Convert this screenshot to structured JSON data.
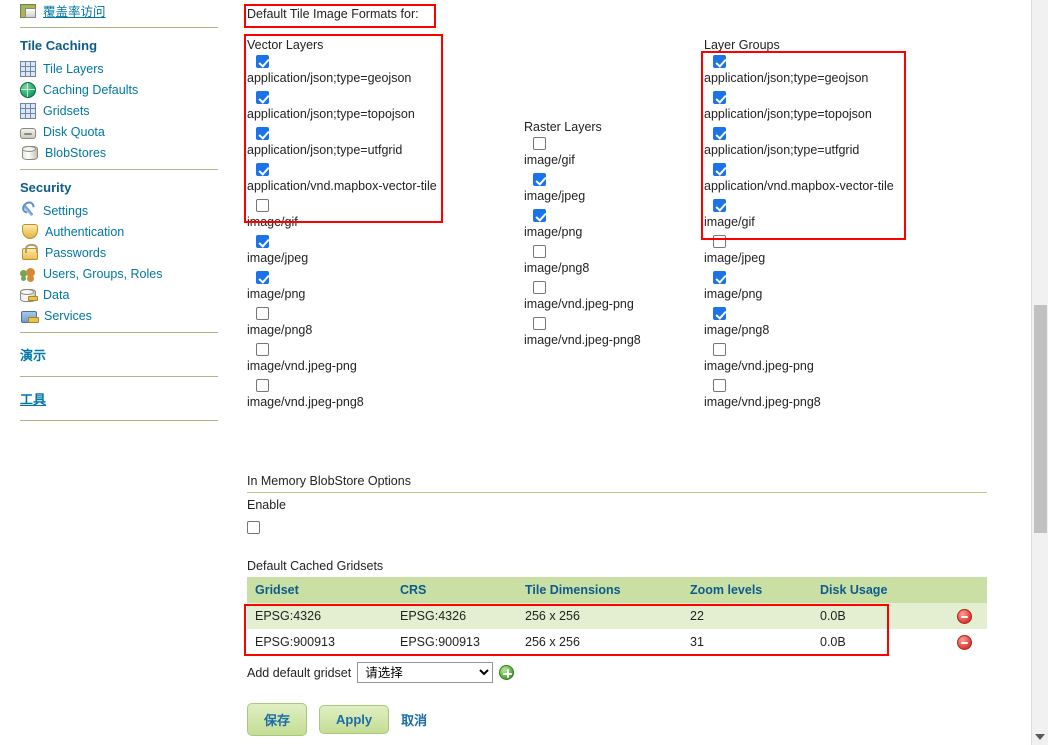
{
  "sidebar": {
    "top_item": {
      "label": "覆盖率访问",
      "icon": "coverage-icon"
    },
    "sections": [
      {
        "title": "Tile Caching",
        "items": [
          {
            "label": "Tile Layers",
            "icon": "tiles-icon"
          },
          {
            "label": "Caching Defaults",
            "icon": "globe-icon"
          },
          {
            "label": "Gridsets",
            "icon": "grid-icon"
          },
          {
            "label": "Disk Quota",
            "icon": "disk-icon"
          },
          {
            "label": "BlobStores",
            "icon": "cylinder-icon"
          }
        ]
      },
      {
        "title": "Security",
        "items": [
          {
            "label": "Settings",
            "icon": "wrench-icon"
          },
          {
            "label": "Authentication",
            "icon": "shield-icon"
          },
          {
            "label": "Passwords",
            "icon": "lock-icon"
          },
          {
            "label": "Users, Groups, Roles",
            "icon": "users-icon"
          },
          {
            "label": "Data",
            "icon": "data-icon"
          },
          {
            "label": "Services",
            "icon": "services-icon"
          }
        ]
      }
    ],
    "links": [
      {
        "label": "演示"
      },
      {
        "label": "工具"
      }
    ]
  },
  "main": {
    "formats_title": "Default Tile Image Formats for:",
    "vector": {
      "heading": "Vector Layers",
      "options": [
        {
          "label": "application/json;type=geojson",
          "checked": true
        },
        {
          "label": "application/json;type=topojson",
          "checked": true
        },
        {
          "label": "application/json;type=utfgrid",
          "checked": true
        },
        {
          "label": "application/vnd.mapbox-vector-tile",
          "checked": true
        },
        {
          "label": "image/gif",
          "checked": false
        },
        {
          "label": "image/jpeg",
          "checked": true
        },
        {
          "label": "image/png",
          "checked": true
        },
        {
          "label": "image/png8",
          "checked": false
        },
        {
          "label": "image/vnd.jpeg-png",
          "checked": false
        },
        {
          "label": "image/vnd.jpeg-png8",
          "checked": false
        }
      ]
    },
    "raster": {
      "heading": "Raster Layers",
      "options": [
        {
          "label": "image/gif",
          "checked": false
        },
        {
          "label": "image/jpeg",
          "checked": true
        },
        {
          "label": "image/png",
          "checked": true
        },
        {
          "label": "image/png8",
          "checked": false
        },
        {
          "label": "image/vnd.jpeg-png",
          "checked": false
        },
        {
          "label": "image/vnd.jpeg-png8",
          "checked": false
        }
      ]
    },
    "layergroups": {
      "heading": "Layer Groups",
      "options": [
        {
          "label": "application/json;type=geojson",
          "checked": true
        },
        {
          "label": "application/json;type=topojson",
          "checked": true
        },
        {
          "label": "application/json;type=utfgrid",
          "checked": true
        },
        {
          "label": "application/vnd.mapbox-vector-tile",
          "checked": true
        },
        {
          "label": "image/gif",
          "checked": true
        },
        {
          "label": "image/jpeg",
          "checked": false
        },
        {
          "label": "image/png",
          "checked": true
        },
        {
          "label": "image/png8",
          "checked": true
        },
        {
          "label": "image/vnd.jpeg-png",
          "checked": false
        },
        {
          "label": "image/vnd.jpeg-png8",
          "checked": false
        }
      ]
    },
    "blobstore": {
      "section_title": "In Memory BlobStore Options",
      "enable_label": "Enable",
      "enable_checked": false
    },
    "gridsets": {
      "section_title": "Default Cached Gridsets",
      "columns": [
        "Gridset",
        "CRS",
        "Tile Dimensions",
        "Zoom levels",
        "Disk Usage"
      ],
      "rows": [
        {
          "gridset": "EPSG:4326",
          "crs": "EPSG:4326",
          "tile_dimensions": "256 x 256",
          "zoom_levels": "22",
          "disk_usage": "0.0B"
        },
        {
          "gridset": "EPSG:900913",
          "crs": "EPSG:900913",
          "tile_dimensions": "256 x 256",
          "zoom_levels": "31",
          "disk_usage": "0.0B"
        }
      ],
      "add_label": "Add default gridset",
      "add_select_value": "请选择",
      "add_select_options": [
        "请选择"
      ]
    },
    "buttons": {
      "save": "保存",
      "apply": "Apply",
      "cancel": "取消"
    }
  },
  "colors": {
    "highlight": "#ff0000",
    "table_header_bg": "#cadfa4",
    "row_alt_bg": "#e4efd2",
    "link": "#0076a3",
    "heading": "#0b5c8c",
    "checkbox_checked": "#1a73e8"
  }
}
